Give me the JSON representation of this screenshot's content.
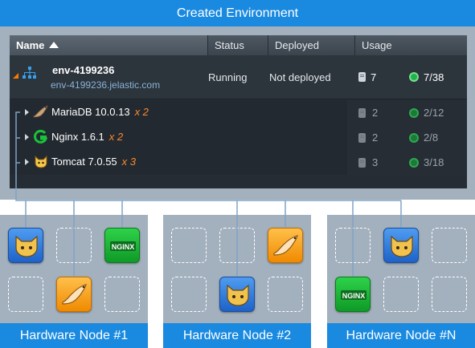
{
  "banner_title": "Created Environment",
  "grid": {
    "columns": {
      "name": "Name",
      "status": "Status",
      "deployed": "Deployed",
      "usage": "Usage"
    },
    "environment": {
      "name": "env-4199236",
      "domain": "env-4199236.jelastic.com",
      "status": "Running",
      "deployed": "Not deployed",
      "cloudlets_reserved": "7",
      "cloudlets_dynamic": "7/38"
    },
    "nodes": [
      {
        "name": "MariaDB 10.0.13",
        "count": "x 2",
        "usage_reserved": "2",
        "usage_dynamic": "2/12",
        "icon": "mariadb-seal-icon"
      },
      {
        "name": "Nginx 1.6.1",
        "count": "x 2",
        "usage_reserved": "2",
        "usage_dynamic": "2/8",
        "icon": "nginx-g-icon"
      },
      {
        "name": "Tomcat 7.0.55",
        "count": "x 3",
        "usage_reserved": "3",
        "usage_dynamic": "3/18",
        "icon": "tomcat-cat-icon"
      }
    ]
  },
  "hardware_nodes": [
    {
      "label": "Hardware Node #1",
      "tiles": [
        "tomcat",
        "empty",
        "nginx",
        "empty",
        "mariadb",
        "empty"
      ]
    },
    {
      "label": "Hardware Node #2",
      "tiles": [
        "empty",
        "empty",
        "mariadb",
        "empty",
        "tomcat",
        "empty"
      ]
    },
    {
      "label": "Hardware Node #N",
      "tiles": [
        "empty",
        "tomcat",
        "empty",
        "nginx",
        "empty",
        "empty"
      ]
    }
  ],
  "tile_text": {
    "nginx": "NGINX"
  },
  "colors": {
    "accent_blue": "#1a8ae0",
    "panel_gray": "#a3b0bd",
    "grid_dark": "#252c33",
    "count_orange": "#ff8a2a",
    "tomcat_tile": "#2f7fe0",
    "mariadb_tile": "#f5a214",
    "nginx_tile": "#19b838"
  }
}
